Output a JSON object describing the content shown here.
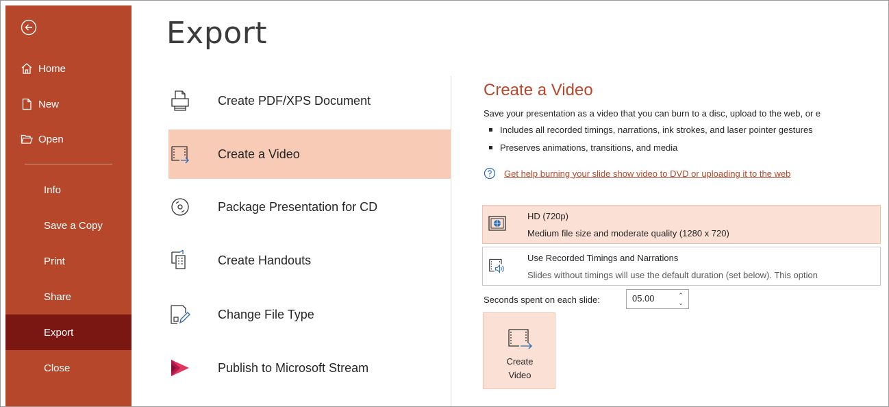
{
  "sidebar": {
    "back_label": "",
    "items": [
      {
        "label": "Home"
      },
      {
        "label": "New"
      },
      {
        "label": "Open"
      },
      {
        "label": "Info"
      },
      {
        "label": "Save a Copy"
      },
      {
        "label": "Print"
      },
      {
        "label": "Share"
      },
      {
        "label": "Export"
      },
      {
        "label": "Close"
      }
    ],
    "active": "Export"
  },
  "page": {
    "title": "Export"
  },
  "options": [
    {
      "label": "Create PDF/XPS Document",
      "icon": "pdf-document-icon"
    },
    {
      "label": "Create a Video",
      "icon": "video-film-icon"
    },
    {
      "label": "Package Presentation for CD",
      "icon": "cd-disc-icon"
    },
    {
      "label": "Create Handouts",
      "icon": "handouts-icon"
    },
    {
      "label": "Change File Type",
      "icon": "change-file-type-icon"
    },
    {
      "label": "Publish to Microsoft Stream",
      "icon": "stream-icon"
    }
  ],
  "pane": {
    "title": "Create a Video",
    "description": "Save your presentation as a video that you can burn to a disc, upload to the web, or e",
    "bullets": [
      "Includes all recorded timings, narrations, ink strokes, and laser pointer gestures",
      "Preserves animations, transitions, and media"
    ],
    "help_link": "Get help burning your slide show video to DVD or uploading it to the web",
    "quality": {
      "title": "HD (720p)",
      "subtitle": "Medium file size and moderate quality (1280 x 720)"
    },
    "timings": {
      "title": "Use Recorded Timings and Narrations",
      "subtitle": "Slides without timings will use the default duration (set below). This option"
    },
    "seconds_label": "Seconds spent on each slide:",
    "seconds_value": "05.00",
    "create_button_line1": "Create",
    "create_button_line2": "Video"
  },
  "colors": {
    "sidebar_bg": "#b7472a",
    "sidebar_active": "#7a1712",
    "selected_bg": "#f8cbb6",
    "accent": "#b7472a"
  }
}
